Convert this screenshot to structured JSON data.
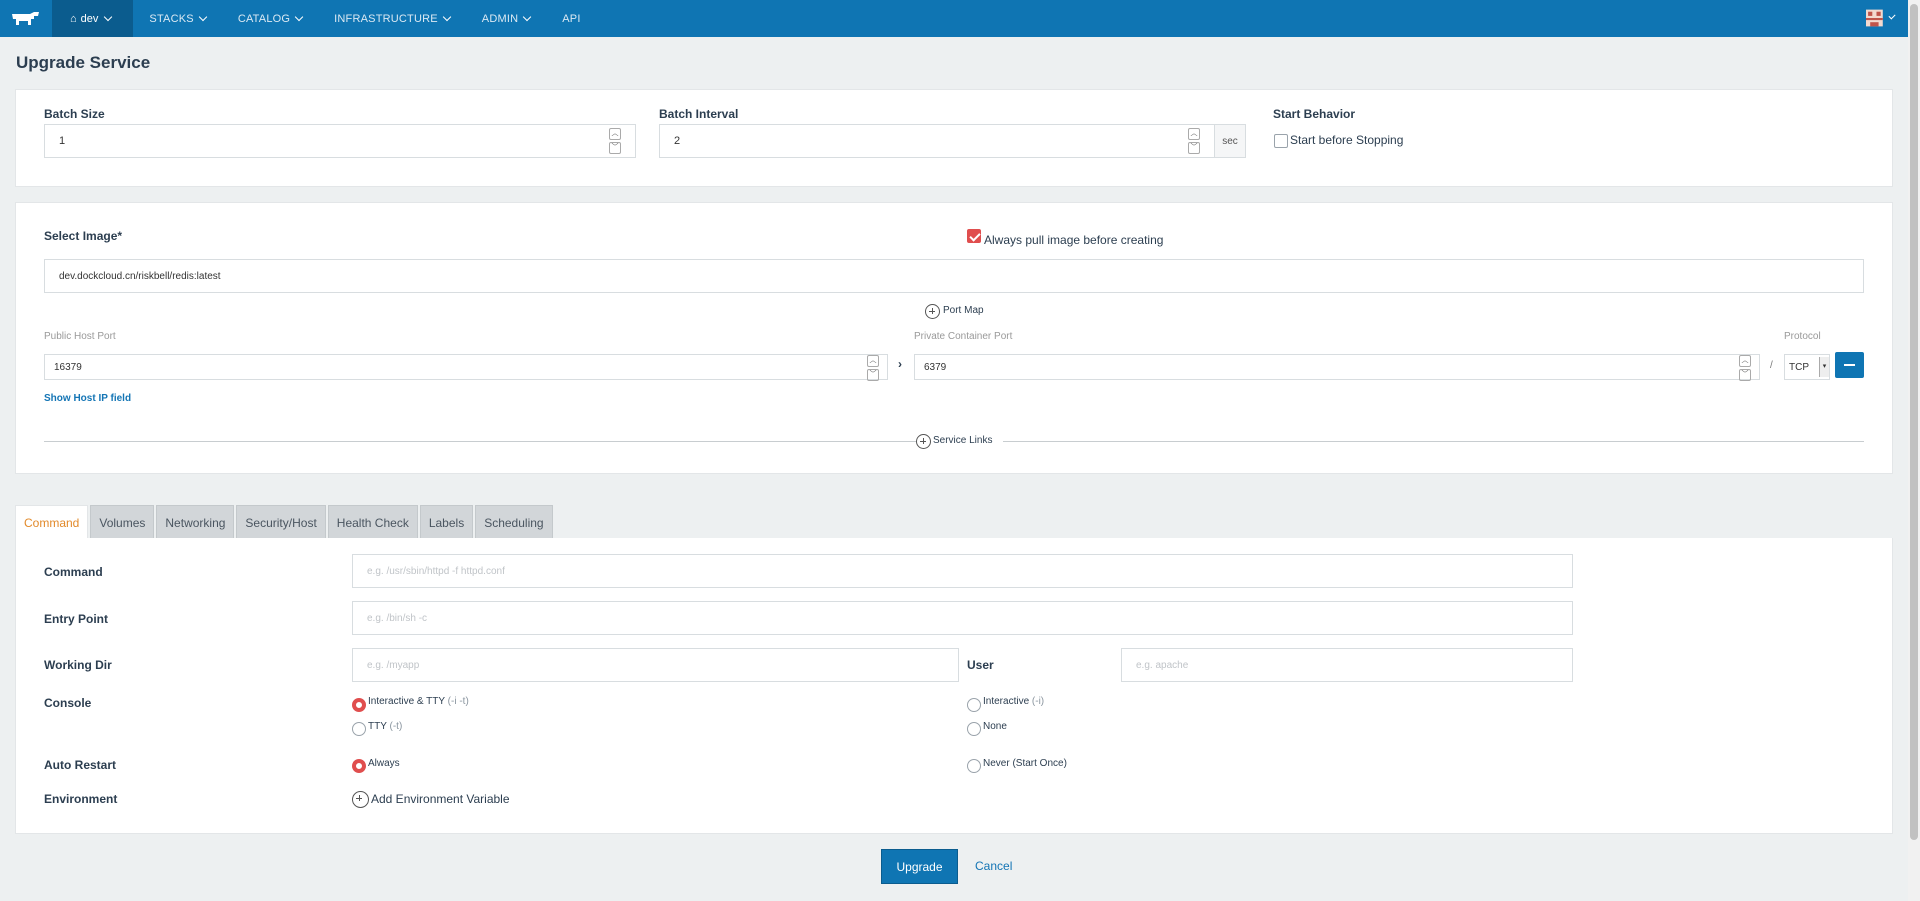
{
  "nav": {
    "env": "dev",
    "items": [
      "STACKS",
      "CATALOG",
      "INFRASTRUCTURE",
      "ADMIN",
      "API"
    ]
  },
  "page": {
    "title": "Upgrade Service"
  },
  "upgrade": {
    "batch_size_label": "Batch Size",
    "batch_size_value": "1",
    "batch_interval_label": "Batch Interval",
    "batch_interval_value": "2",
    "batch_interval_unit": "sec",
    "start_behavior_label": "Start Behavior",
    "start_before_stopping": "Start before Stopping"
  },
  "image": {
    "label": "Select Image*",
    "always_pull": "Always pull image before creating",
    "value": "dev.dockcloud.cn/riskbell/redis:latest",
    "port_map": "Port Map",
    "public_port_label": "Public Host Port",
    "public_port_value": "16379",
    "private_port_label": "Private Container Port",
    "private_port_value": "6379",
    "protocol_label": "Protocol",
    "protocol_separator": "/",
    "protocol_value": "TCP",
    "show_host_ip": "Show Host IP field",
    "service_links": "Service Links"
  },
  "tabs": [
    "Command",
    "Volumes",
    "Networking",
    "Security/Host",
    "Health Check",
    "Labels",
    "Scheduling"
  ],
  "command": {
    "command_label": "Command",
    "command_placeholder": "e.g. /usr/sbin/httpd -f httpd.conf",
    "entrypoint_label": "Entry Point",
    "entrypoint_placeholder": "e.g. /bin/sh -c",
    "workdir_label": "Working Dir",
    "workdir_placeholder": "e.g. /myapp",
    "user_label": "User",
    "user_placeholder": "e.g. apache",
    "console_label": "Console",
    "console_options": [
      {
        "label": "Interactive & TTY",
        "hint": "(-i -t)"
      },
      {
        "label": "Interactive",
        "hint": "(-i)"
      },
      {
        "label": "TTY",
        "hint": "(-t)"
      },
      {
        "label": "None",
        "hint": ""
      }
    ],
    "auto_restart_label": "Auto Restart",
    "restart_always": "Always",
    "restart_never": "Never (Start Once)",
    "environment_label": "Environment",
    "add_env": "Add Environment Variable"
  },
  "actions": {
    "upgrade": "Upgrade",
    "cancel": "Cancel"
  },
  "colors": {
    "nav": "#0f75b3",
    "accent": "#e04e4e",
    "tab_active": "#e28a2b"
  }
}
